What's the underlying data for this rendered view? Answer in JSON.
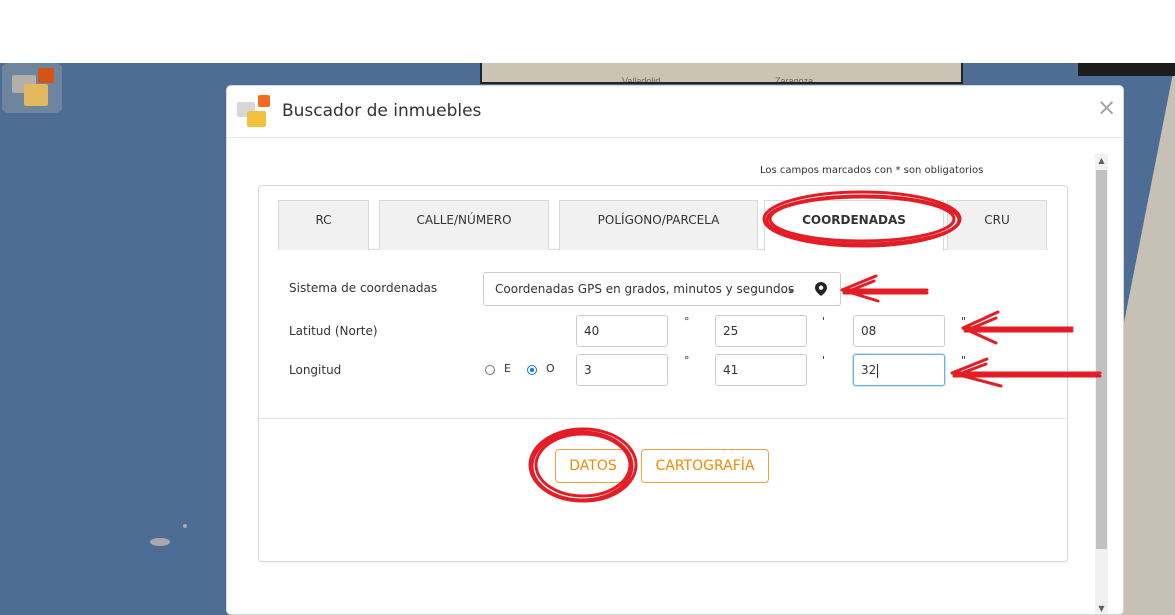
{
  "map": {
    "city_labels": [
      "Valladolid",
      "Zaragoza"
    ]
  },
  "dialog": {
    "title": "Buscador de inmuebles",
    "close_icon": "×",
    "required_note": "Los campos marcados con * son obligatorios",
    "tabs": [
      {
        "label": "RC",
        "active": false
      },
      {
        "label": "CALLE/NÚMERO",
        "active": false
      },
      {
        "label": "POLÍGONO/PARCELA",
        "active": false
      },
      {
        "label": "COORDENADAS",
        "active": true
      },
      {
        "label": "CRU",
        "active": false
      }
    ],
    "coordinate_system": {
      "label": "Sistema de coordenadas",
      "selected": "Coordenadas GPS en grados, minutos y segundos"
    },
    "latitude": {
      "label": "Latitud (Norte)",
      "degrees": "40",
      "minutes": "25",
      "seconds": "08"
    },
    "longitude": {
      "label": "Longitud",
      "east_label": "E",
      "west_label": "O",
      "selected_direction": "O",
      "degrees": "3",
      "minutes": "41",
      "seconds": "32"
    },
    "units": {
      "degree": "°",
      "minute": "'",
      "second": "\""
    },
    "buttons": {
      "data": "DATOS",
      "cartography": "CARTOGRAFÍA"
    }
  },
  "colors": {
    "map_water": "#4d6d95",
    "accent_orange": "#f08a00",
    "annotation_red": "#e31d26",
    "focus_blue": "#66afe9"
  },
  "icons": {
    "location": "map-pin-icon",
    "dropdown": "chevron-down-icon",
    "close": "close-icon"
  }
}
